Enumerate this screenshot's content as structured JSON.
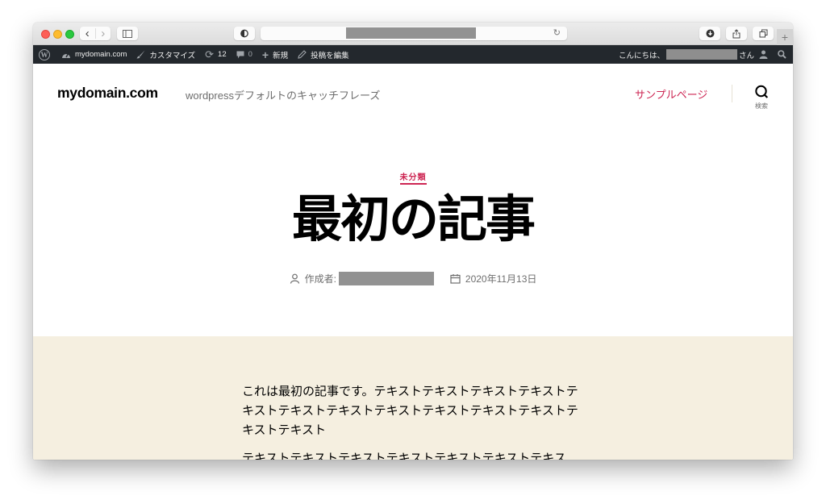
{
  "browser": {
    "url_redacted": true,
    "buttons": {
      "back": "‹",
      "forward": "›",
      "new_tab": "+"
    },
    "icons": [
      "sidebar-icon",
      "privacy-shield-icon",
      "reload-icon",
      "download-icon",
      "share-icon",
      "tabs-overview-icon"
    ]
  },
  "admin_bar": {
    "wp_logo": "W",
    "site_name": "mydomain.com",
    "customize": "カスタマイズ",
    "updates_count": "12",
    "comments_count": "0",
    "new": "新規",
    "edit_post": "投稿を編集",
    "greeting": "こんにちは、",
    "greeting_suffix": "さん"
  },
  "site": {
    "title": "mydomain.com",
    "description": "wordpressデフォルトのキャッチフレーズ",
    "nav": [
      {
        "label": "サンプルページ"
      }
    ],
    "search_label": "検索"
  },
  "post": {
    "category": "未分類",
    "title": "最初の記事",
    "author_label": "作成者:",
    "date": "2020年11月13日",
    "paragraphs": [
      "これは最初の記事です。テキストテキストテキストテキストテキストテキストテキストテキストテキストテキストテキストテキストテキスト",
      "テキストテキストテキストテキストテキストテキストテキス"
    ]
  },
  "colors": {
    "accent": "#cd2653",
    "admin_bar_bg": "#23282d",
    "content_bg": "#f5efe0"
  }
}
